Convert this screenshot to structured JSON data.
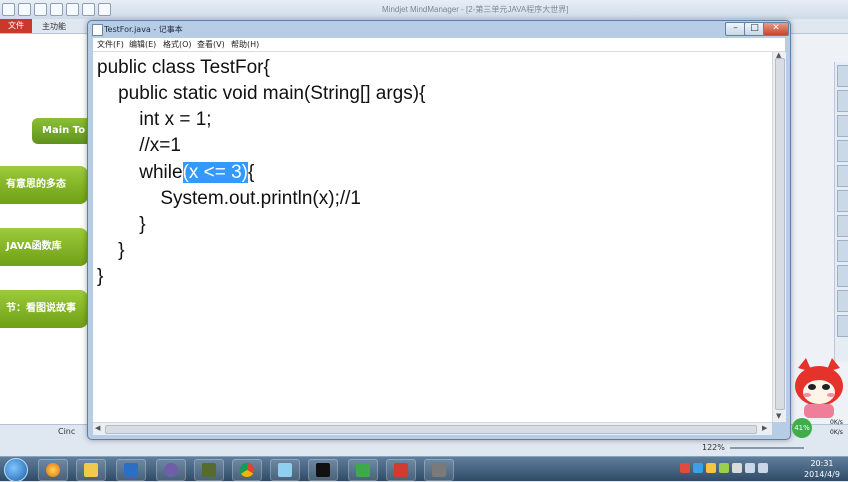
{
  "background_app": {
    "window_title": "Mindjet MindManager - [2-第三单元JAVA程序大世界]",
    "file_tab": "文件",
    "ribbon_tab": "主功能",
    "main_topic": "Main To",
    "topics": [
      "有意思的多态",
      "JAVA函数库",
      "节：看图说故事"
    ],
    "sheet_tab": "Cinc",
    "zoom": "122%"
  },
  "notepad": {
    "title": "TestFor.java - 记事本",
    "menu": [
      "文件(F)",
      "编辑(E)",
      "格式(O)",
      "查看(V)",
      "帮助(H)"
    ],
    "code": {
      "line1": "public class TestFor{",
      "line2": "    public static void main(String[] args){",
      "line3": "        int x = 1;",
      "line4": "        //x=1",
      "line5_before": "        while",
      "line5_selected": "(x <= 3)",
      "line5_after": "{",
      "line6": "            System.out.println(x);//1",
      "line7": "        }",
      "line8": "    }",
      "line9": "}"
    }
  },
  "tray": {
    "net_percent": "41%",
    "net_up": "0K/s",
    "net_down": "0K/s"
  },
  "clock": {
    "time": "20:31",
    "date": "2014/4/9"
  }
}
